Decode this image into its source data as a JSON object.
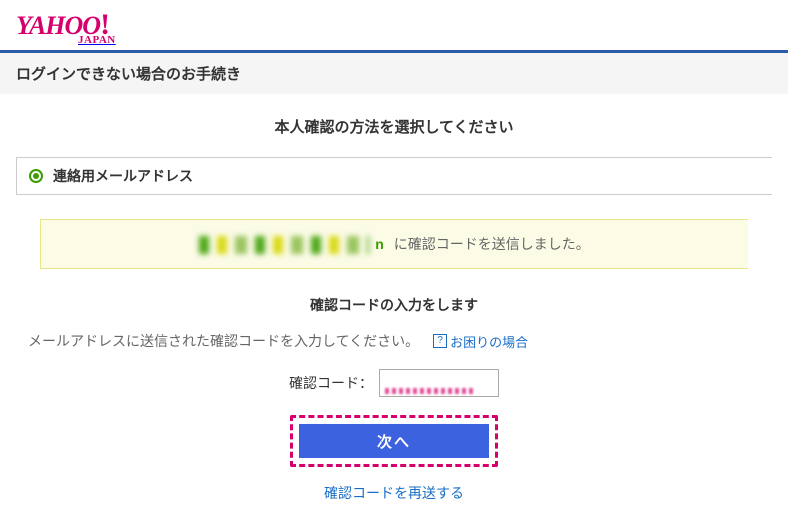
{
  "logo": {
    "main": "YAHOO",
    "bang": "!",
    "sub": "JAPAN"
  },
  "titlebar": "ログインできない場合のお手続き",
  "select_method_title": "本人確認の方法を選択してください",
  "option": {
    "label": "連絡用メールアドレス"
  },
  "notice": {
    "sent_text": "に確認コードを送信しました。",
    "tail": "n"
  },
  "enter_code_title": "確認コードの入力をします",
  "instruction": "メールアドレスに送信された確認コードを入力してください。",
  "help": {
    "icon": "?",
    "label": "お困りの場合"
  },
  "form": {
    "label": "確認コード："
  },
  "buttons": {
    "next": "次へ"
  },
  "resend": {
    "label": "確認コードを再送する"
  }
}
